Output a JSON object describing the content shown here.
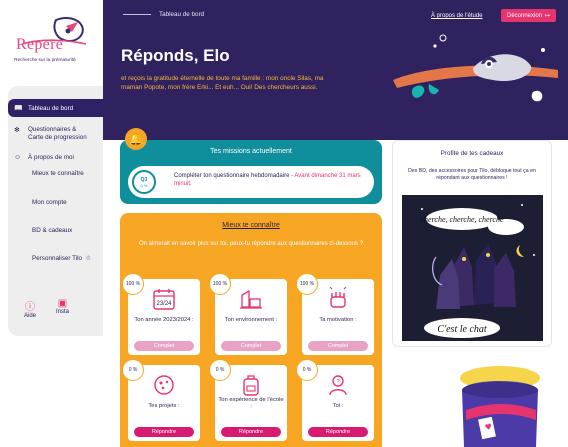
{
  "brand": {
    "name": "Repere",
    "tagline": "Recherche sur la prématurité"
  },
  "sidebar": {
    "items": [
      {
        "label": "Tableau de bord",
        "icon": "book-icon",
        "active": true
      },
      {
        "label": "Questionnaires & Carte de progression",
        "icon": "brain-icon",
        "active": false
      },
      {
        "label": "À propos de moi",
        "icon": "user-icon",
        "active": false
      }
    ],
    "sub_items": [
      "Mieux te connaître",
      "Mon compte",
      "BD & cadeaux",
      "Personnaliser Tilo"
    ],
    "help": {
      "aide": "Aide",
      "insta": "Insta"
    }
  },
  "header": {
    "breadcrumb": "Tableau de bord",
    "about_link": "À propos de l'étude",
    "logout_label": "Déconnexion",
    "title": "Réponds, Elo",
    "subtitle": "et reçois la gratitude éternelle de toute ma famille : mon oncle Silas, ma maman Popote, mon frère Erki... Et euh... Oui! Des chercheurs aussi."
  },
  "missions": {
    "title": "Tes missions actuellement",
    "gauge_label": "Q3",
    "gauge_pct": "0 %",
    "text": "Compléter ton questionnaire hebdomadaire",
    "deadline": "- Avant dimanche 31 mars minuit."
  },
  "know": {
    "title": "Mieux te connaître",
    "description": "On aimerait en savoir plus sur toi, peux-tu répondre aux questionnaires ci-dessous ?",
    "cards": [
      {
        "pct": "100 %",
        "label": "Ton année 2023/2024 :",
        "button": "Complet",
        "status": "done",
        "icon": "calendar-icon"
      },
      {
        "pct": "100 %",
        "label": "Ton environnement :",
        "button": "Complet",
        "status": "done",
        "icon": "environment-icon"
      },
      {
        "pct": "100 %",
        "label": "Ta motivation :",
        "button": "Complet",
        "status": "done",
        "icon": "fist-icon"
      },
      {
        "pct": "0 %",
        "label": "Tes projets :",
        "button": "Répondre",
        "status": "todo",
        "icon": "projects-icon"
      },
      {
        "pct": "0 %",
        "label": "Ton expérience de l'école :",
        "button": "Répondre",
        "status": "todo",
        "icon": "backpack-icon"
      },
      {
        "pct": "0 %",
        "label": "Toi :",
        "button": "Répondre",
        "status": "todo",
        "icon": "person-icon"
      }
    ],
    "calendar_text": "23/24"
  },
  "gifts": {
    "title": "Profite de tes cadeaux",
    "description": "Des BD, des accessoires pour Tilo, débloque tout ça en répondant aux questionnaires !",
    "comic_bubble": "cherche, cherche, cherche",
    "comic_caption": "C'est le chat"
  },
  "colors": {
    "header_bg": "#30225f",
    "accent_pink": "#e6356e",
    "missions_teal": "#0f8e9c",
    "know_orange": "#f6a623",
    "subtitle_yellow": "#f6b73c"
  }
}
